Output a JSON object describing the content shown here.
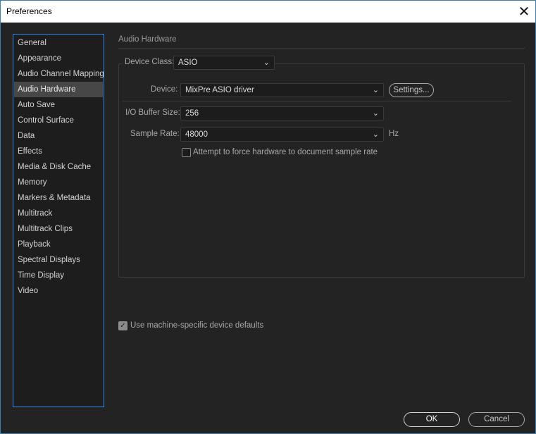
{
  "window": {
    "title": "Preferences"
  },
  "sidebar": {
    "items": [
      {
        "label": "General"
      },
      {
        "label": "Appearance"
      },
      {
        "label": "Audio Channel Mapping"
      },
      {
        "label": "Audio Hardware",
        "active": true
      },
      {
        "label": "Auto Save"
      },
      {
        "label": "Control Surface"
      },
      {
        "label": "Data"
      },
      {
        "label": "Effects"
      },
      {
        "label": "Media & Disk Cache"
      },
      {
        "label": "Memory"
      },
      {
        "label": "Markers & Metadata"
      },
      {
        "label": "Multitrack"
      },
      {
        "label": "Multitrack Clips"
      },
      {
        "label": "Playback"
      },
      {
        "label": "Spectral Displays"
      },
      {
        "label": "Time Display"
      },
      {
        "label": "Video"
      }
    ]
  },
  "main": {
    "section_title": "Audio Hardware",
    "device_class": {
      "label": "Device Class:",
      "value": "ASIO"
    },
    "device": {
      "label": "Device:",
      "value": "MixPre ASIO driver",
      "settings_label": "Settings..."
    },
    "buffer_size": {
      "label": "I/O Buffer Size:",
      "value": "256"
    },
    "sample_rate": {
      "label": "Sample Rate:",
      "value": "48000",
      "unit": "Hz"
    },
    "force_rate": {
      "label": "Attempt to force hardware to document sample rate",
      "checked": false
    },
    "machine_defaults": {
      "label": "Use machine-specific device defaults",
      "checked": true
    }
  },
  "footer": {
    "ok_label": "OK",
    "cancel_label": "Cancel"
  },
  "icons": {
    "close": "close-icon",
    "chevron": "chevron-down-icon",
    "check": "check-icon"
  },
  "colors": {
    "background": "#232323",
    "sidebar_border": "#2d8ceb",
    "active_item": "#474747",
    "text": "#d2d2d2"
  }
}
